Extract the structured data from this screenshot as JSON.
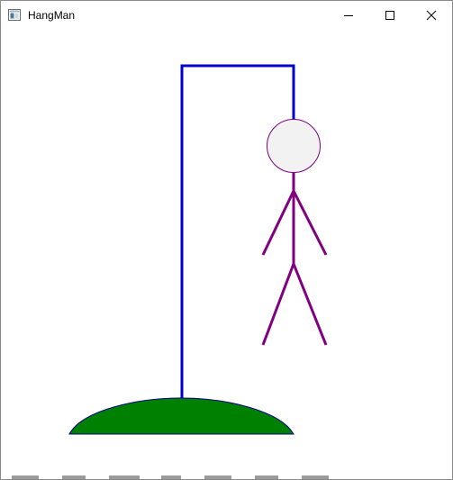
{
  "window": {
    "title": "HangMan",
    "app_icon": "window-app-icon",
    "buttons": {
      "minimize_icon": "minimize-icon",
      "maximize_icon": "maximize-icon",
      "close_icon": "close-icon"
    }
  },
  "scene": {
    "gallows_color": "#0000cc",
    "figure_color": "#800080",
    "head_fill": "#f2f2f2",
    "ground_fill": "#008000",
    "ground_stroke": "#00008b",
    "parts_drawn": [
      "head",
      "body",
      "left-arm",
      "right-arm",
      "left-leg",
      "right-leg"
    ]
  }
}
